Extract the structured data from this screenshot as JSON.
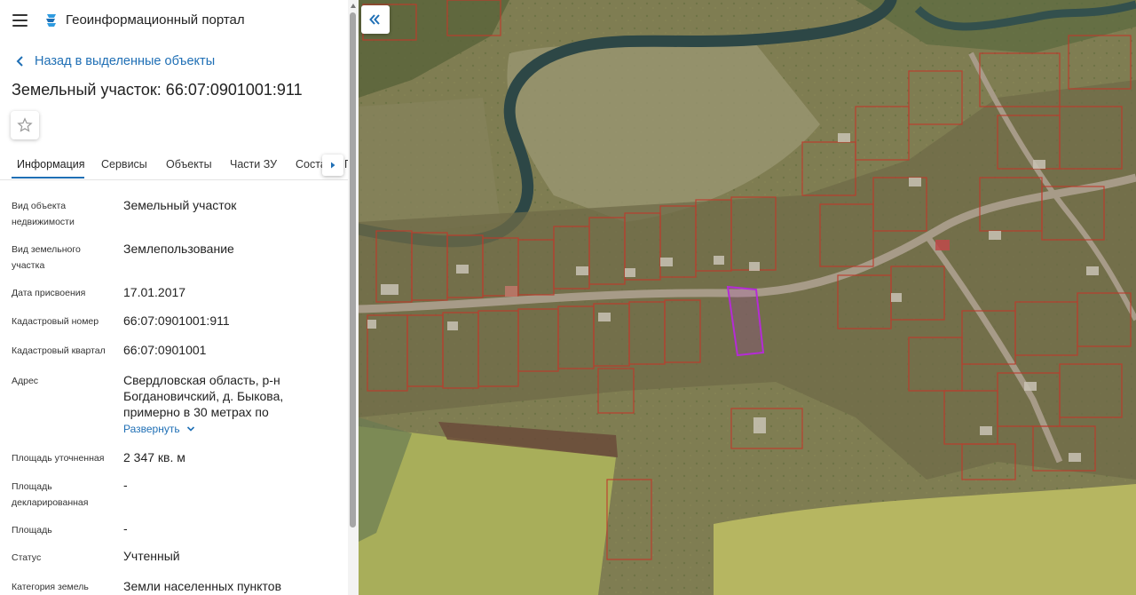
{
  "app": {
    "title": "Геоинформационный портал"
  },
  "nav": {
    "back_label": "Назад в выделенные объекты"
  },
  "object": {
    "title": "Земельный участок: 66:07:0901001:911"
  },
  "tabs": [
    {
      "label": "Информация",
      "active": true
    },
    {
      "label": "Сервисы"
    },
    {
      "label": "Объекты"
    },
    {
      "label": "Части ЗУ"
    },
    {
      "label": "Соста"
    },
    {
      "label": "П"
    }
  ],
  "properties": [
    {
      "label": "Вид объекта недвижимости",
      "value": "Земельный участок"
    },
    {
      "label": "Вид земельного участка",
      "value": "Землепользование"
    },
    {
      "label": "Дата присвоения",
      "value": "17.01.2017"
    },
    {
      "label": "Кадастровый номер",
      "value": "66:07:0901001:911"
    },
    {
      "label": "Кадастровый квартал",
      "value": "66:07:0901001"
    },
    {
      "label": "Адрес",
      "value": "Свердловская область, р-н Богдановичский, д. Быкова, примерно в 30 метрах по"
    },
    {
      "label": "Площадь уточненная",
      "value": "2 347 кв. м"
    },
    {
      "label": "Площадь декларированная",
      "value": "-"
    },
    {
      "label": "Площадь",
      "value": "-"
    },
    {
      "label": "Статус",
      "value": "Учтенный"
    },
    {
      "label": "Категория земель",
      "value": "Земли населенных пунктов"
    }
  ],
  "address_expand_label": "Развернуть",
  "icons": {
    "menu": "hamburger-icon",
    "logo": "portal-logo-icon",
    "back": "chevron-left-icon",
    "favorite": "star-outline-icon",
    "tab_scroll": "caret-right-icon",
    "expand": "chevron-down-icon",
    "collapse_panel": "double-chevron-left-icon"
  },
  "colors": {
    "accent": "#1f6fb5",
    "selected_parcel": "#b52bd6",
    "parcel_boundary": "#c0392b"
  }
}
